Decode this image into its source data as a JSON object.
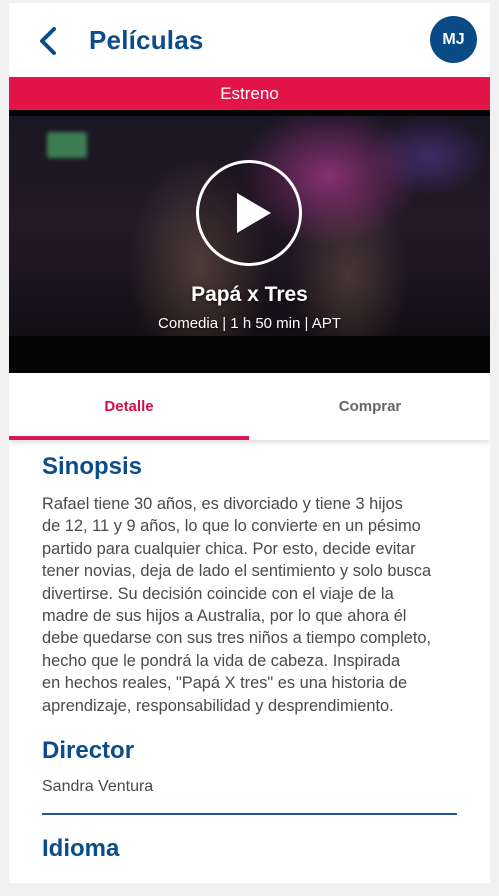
{
  "header": {
    "title": "Películas",
    "avatar_initials": "MJ",
    "back_icon": "chevron-left-icon"
  },
  "banner": {
    "label": "Estreno"
  },
  "hero": {
    "title": "Papá x Tres",
    "meta": "Comedia | 1 h 50 min | APT",
    "play_icon": "play-icon"
  },
  "tabs": [
    {
      "label": "Detalle",
      "active": true
    },
    {
      "label": "Comprar",
      "active": false
    }
  ],
  "detail": {
    "synopsis_heading": "Sinopsis",
    "synopsis_lines": [
      "Rafael tiene 30 años, es divorciado y tiene 3 hijos",
      "de 12, 11 y 9 años, lo que lo convierte en un pésimo",
      "partido para cualquier chica. Por esto, decide evitar",
      "tener novias, deja de lado el sentimiento y solo busca",
      "divertirse. Su decisión coincide con el viaje de la",
      "madre de sus hijos a Australia, por lo que ahora él",
      "debe quedarse con sus tres niños a tiempo completo,",
      "hecho que le pondrá la vida de cabeza. Inspirada",
      "en hechos reales, \"Papá X tres\" es una historia de",
      "aprendizaje, responsabilidad y desprendimiento."
    ],
    "director_heading": "Director",
    "director_name": "Sandra  Ventura",
    "language_heading": "Idioma"
  },
  "colors": {
    "primary": "#0b4c8c",
    "accent": "#e31448",
    "text": "#4a4a4a"
  }
}
